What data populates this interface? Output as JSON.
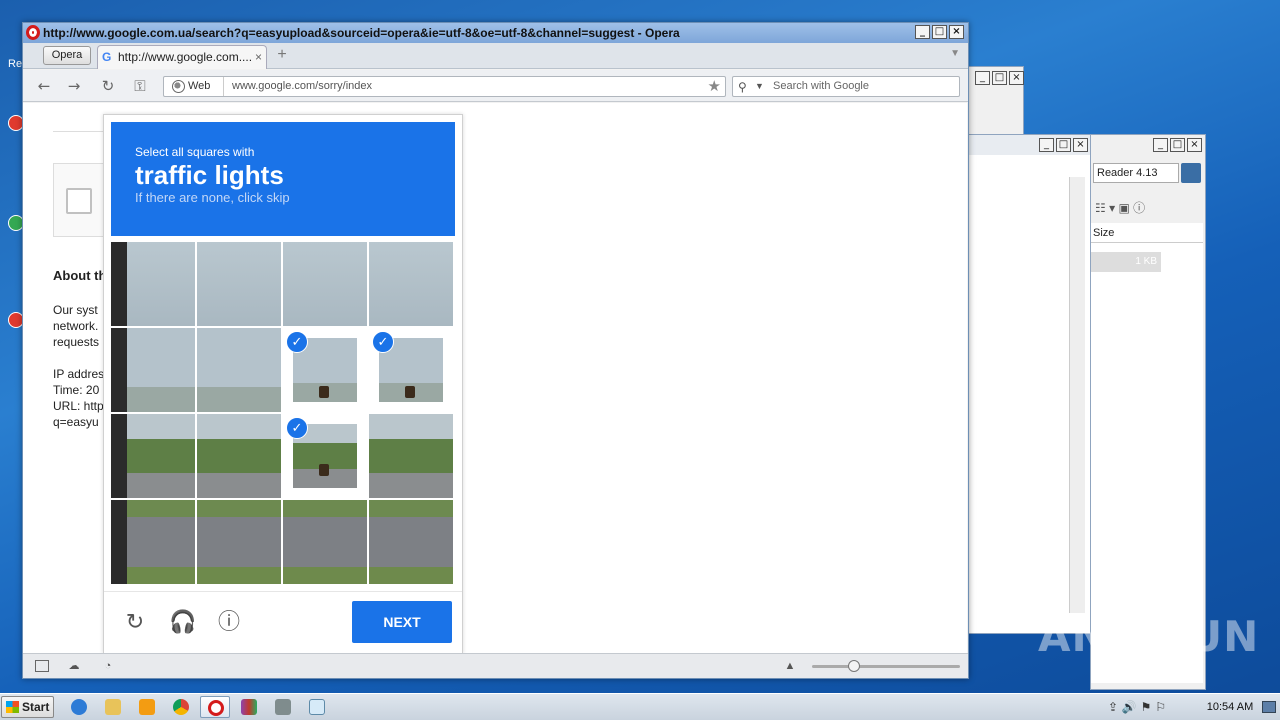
{
  "desktop": {
    "icon_label_re": "Re"
  },
  "bg_windows": {
    "explorer_address": "Reader 4.13",
    "explorer_column": "Size",
    "explorer_size_value": "1 KB"
  },
  "opera": {
    "title": "http://www.google.com.ua/search?q=easyupload&sourceid=opera&ie=utf-8&oe=utf-8&channel=suggest - Opera",
    "menu_label": "Opera",
    "tab_title": "http://www.google.com....",
    "tab_close": "×",
    "new_tab": "+",
    "nav": {
      "back": "←",
      "forward": "→",
      "reload": "↻",
      "key": "⚿"
    },
    "address": {
      "web_label": "Web",
      "url": "www.google.com/sorry/index"
    },
    "search": {
      "placeholder": "Search with Google"
    }
  },
  "page": {
    "heading": "About th",
    "para": [
      "Our syst",
      "network.",
      "requests"
    ],
    "info": [
      "IP addres",
      "Time: 20",
      "URL: http",
      "q=easyu"
    ]
  },
  "captcha": {
    "instruction": "Select all squares with",
    "target": "traffic lights",
    "hint": "If there are none, click skip",
    "selected": [
      [
        1,
        2
      ],
      [
        1,
        3
      ],
      [
        2,
        2
      ]
    ],
    "next_label": "NEXT",
    "footer_icons": [
      "reload-icon",
      "headphones-icon",
      "info-icon"
    ]
  },
  "taskbar": {
    "start_label": "Start",
    "clock": "10:54 AM"
  },
  "watermark": "ANY RUN",
  "colors": {
    "captcha_blue": "#1a73e8",
    "desktop_blue": "#1b5fae"
  }
}
